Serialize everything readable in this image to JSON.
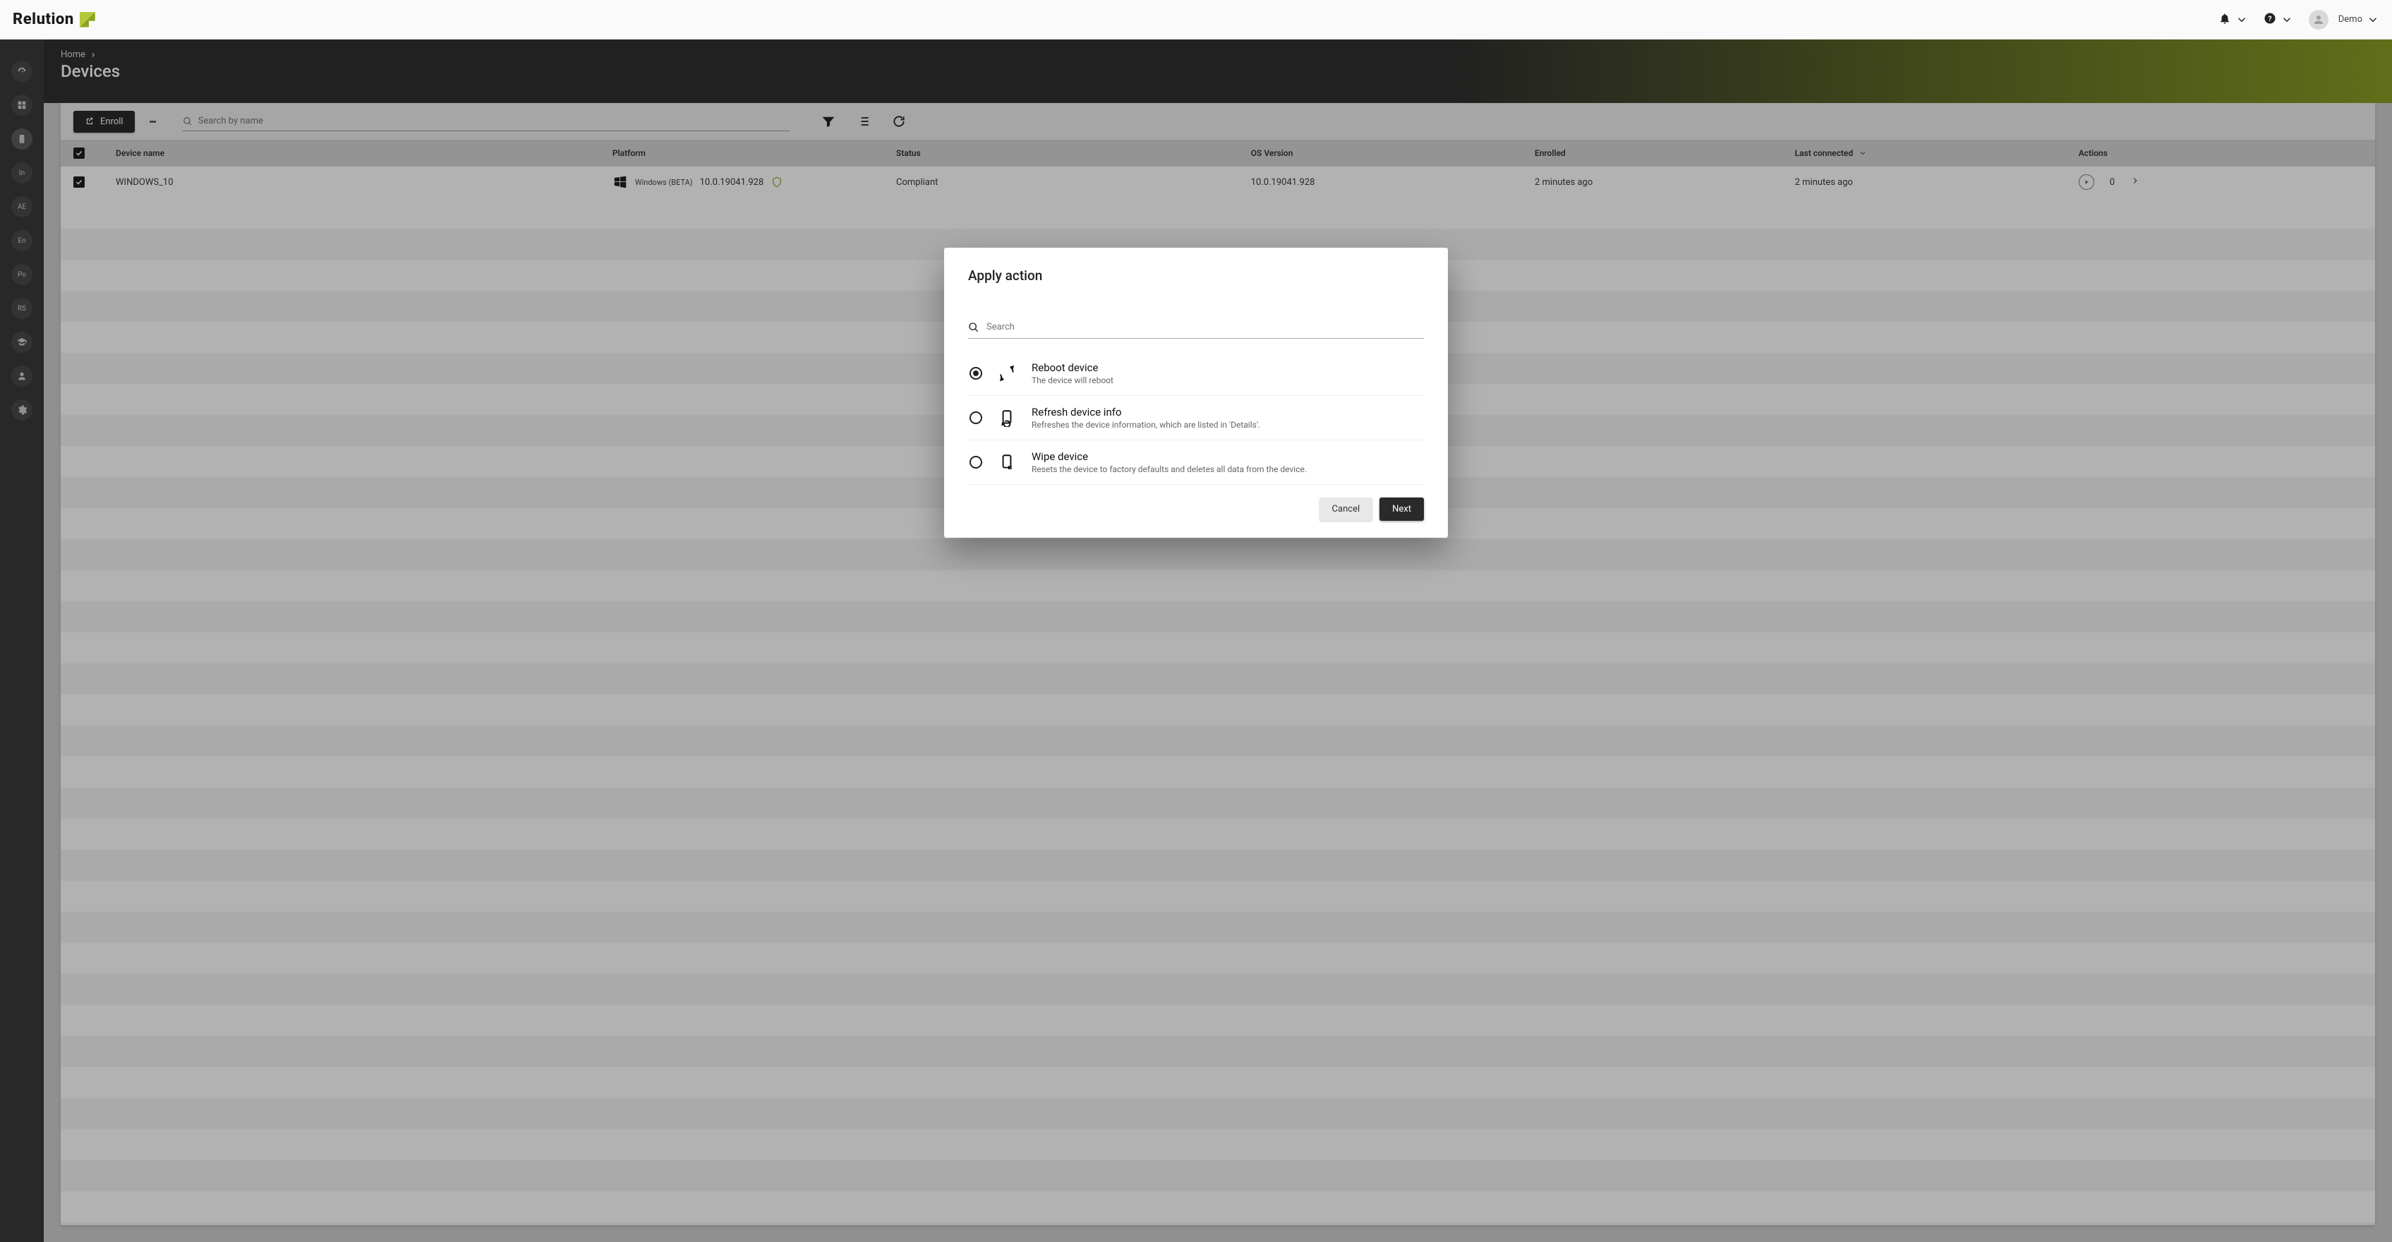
{
  "topbar": {
    "brand": "Relution",
    "user_label": "Demo"
  },
  "sidebar": {
    "items": [
      {
        "kind": "icon",
        "name": "dashboard-icon"
      },
      {
        "kind": "icon",
        "name": "apps-icon"
      },
      {
        "kind": "icon",
        "name": "device-icon",
        "active": true
      },
      {
        "kind": "text",
        "label": "In"
      },
      {
        "kind": "text",
        "label": "AE"
      },
      {
        "kind": "text",
        "label": "En"
      },
      {
        "kind": "text",
        "label": "Po"
      },
      {
        "kind": "text",
        "label": "RS"
      },
      {
        "kind": "icon",
        "name": "education-icon"
      },
      {
        "kind": "icon",
        "name": "user-icon"
      },
      {
        "kind": "icon",
        "name": "gear-icon"
      }
    ]
  },
  "hero": {
    "crumb_home": "Home",
    "title": "Devices"
  },
  "toolbar": {
    "enroll_label": "Enroll",
    "search_placeholder": "Search by name"
  },
  "table": {
    "headers": {
      "device_name": "Device name",
      "platform": "Platform",
      "status": "Status",
      "os_version": "OS Version",
      "enrolled": "Enrolled",
      "last_connected": "Last connected",
      "actions": "Actions"
    },
    "rows": [
      {
        "checked": true,
        "device_name": "WINDOWS_10",
        "platform_name": "Windows (BETA)",
        "platform_ver": "10.0.19041.928",
        "status": "Compliant",
        "os_version": "10.0.19041.928",
        "enrolled": "2 minutes ago",
        "last_connected": "2 minutes ago",
        "action_count": "0"
      }
    ]
  },
  "modal": {
    "title": "Apply action",
    "search_placeholder": "Search",
    "options": [
      {
        "title": "Reboot device",
        "desc": "The device will reboot",
        "selected": true
      },
      {
        "title": "Refresh device info",
        "desc": "Refreshes the device information, which are listed in 'Details'.",
        "selected": false
      },
      {
        "title": "Wipe device",
        "desc": "Resets the device to factory defaults and deletes all data from the device.",
        "selected": false
      }
    ],
    "cancel_label": "Cancel",
    "next_label": "Next"
  }
}
